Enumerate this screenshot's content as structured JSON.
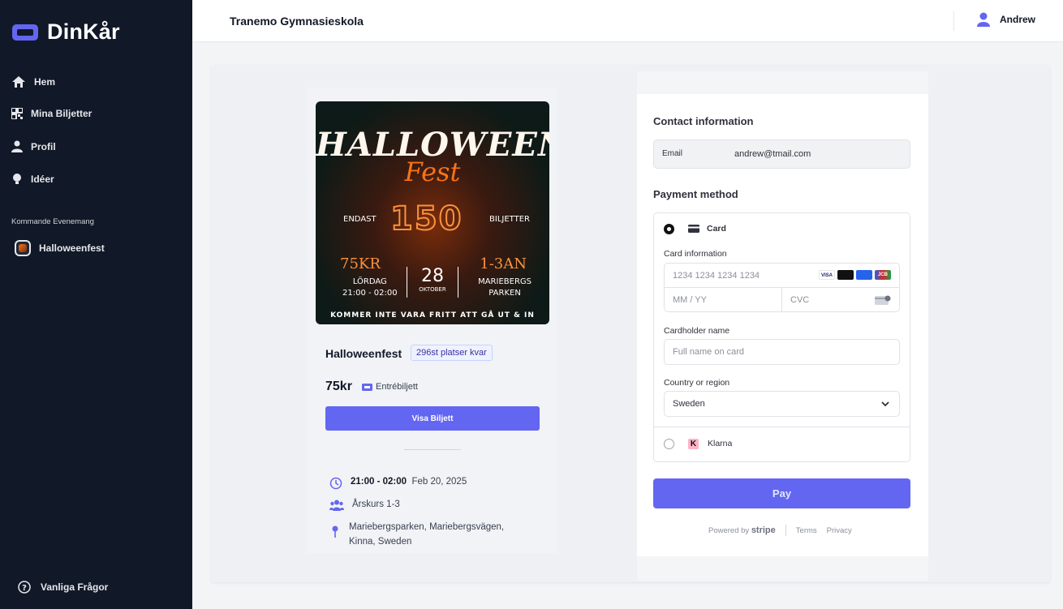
{
  "app": {
    "brand": "DinKår"
  },
  "sidebar": {
    "items": [
      {
        "label": "Hem"
      },
      {
        "label": "Mina Biljetter"
      },
      {
        "label": "Profil"
      },
      {
        "label": "Idéer"
      }
    ],
    "section_label": "Kommande Evenemang",
    "events": [
      {
        "label": "Halloweenfest"
      }
    ],
    "faq_label": "Vanliga Frågor"
  },
  "header": {
    "school": "Tranemo Gymnasieskola",
    "user": "Andrew"
  },
  "poster": {
    "title_line1": "HALLOWEEN",
    "title_line2": "Fest",
    "left_tag": "ENDAST",
    "big_number": "150",
    "right_tag": "BILJETTER",
    "price": "75KR",
    "day_line1": "LÖRDAG",
    "day_line2": "21:00 - 02:00",
    "date_num": "28",
    "date_month": "OKTOBER",
    "grade": "1-3AN",
    "place_line1": "MARIEBERGS",
    "place_line2": "PARKEN",
    "footer": "KOMMER INTE VARA FRITT ATT GÅ UT & IN"
  },
  "event": {
    "name": "Halloweenfest",
    "seats_left": "296st platser kvar",
    "price": "75kr",
    "ticket_type": "Entrébiljett",
    "show_ticket_label": "Visa Biljett",
    "time": "21:00 - 02:00",
    "date": "Feb 20, 2025",
    "audience": "Årskurs 1-3",
    "location_line1": "Mariebergsparken, Mariebergsvägen,",
    "location_line2": "Kinna, Sweden"
  },
  "checkout": {
    "contact_heading": "Contact information",
    "email_label": "Email",
    "email_value": "andrew@tmail.com",
    "payment_heading": "Payment method",
    "card_option": "Card",
    "card_info_label": "Card information",
    "card_number_placeholder": "1234 1234 1234 1234",
    "expiry_placeholder": "MM / YY",
    "cvc_placeholder": "CVC",
    "cardholder_label": "Cardholder name",
    "cardholder_placeholder": "Full name on card",
    "country_label": "Country or region",
    "country_value": "Sweden",
    "klarna_option": "Klarna",
    "pay_label": "Pay",
    "powered_by": "Powered by",
    "stripe": "stripe",
    "terms": "Terms",
    "privacy": "Privacy",
    "card_brands": [
      "VISA",
      "mastercard",
      "amex",
      "JCB"
    ]
  },
  "colors": {
    "accent": "#6366f1",
    "sidebar": "#111827",
    "poster_orange": "#fb923c"
  }
}
